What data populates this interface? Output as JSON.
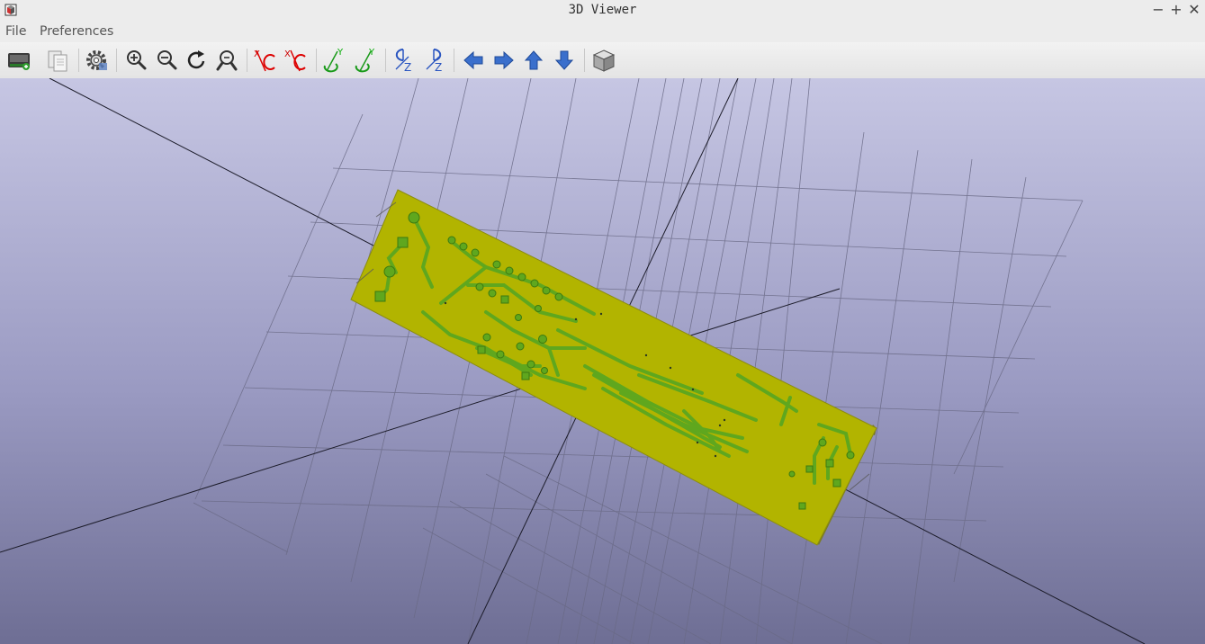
{
  "window": {
    "title": "3D Viewer",
    "minimize": "−",
    "maximize": "+",
    "close": "✕"
  },
  "menubar": {
    "file": "File",
    "preferences": "Preferences"
  },
  "toolbar": {
    "buttons": [
      {
        "name": "save-image-button",
        "icon": "camera-save-icon"
      },
      {
        "name": "copy-to-clipboard-button",
        "icon": "copy-icon"
      },
      {
        "name": "settings-button",
        "icon": "gear-icon"
      },
      {
        "name": "zoom-in-button",
        "icon": "zoom-in-icon"
      },
      {
        "name": "zoom-out-button",
        "icon": "zoom-out-icon"
      },
      {
        "name": "redraw-button",
        "icon": "refresh-icon"
      },
      {
        "name": "zoom-fit-button",
        "icon": "zoom-fit-icon"
      },
      {
        "name": "rotate-x-ccw-button",
        "icon": "rotate-x-icon",
        "axis": "X"
      },
      {
        "name": "rotate-x-cw-button",
        "icon": "rotate-x-icon",
        "axis": "X"
      },
      {
        "name": "rotate-y-ccw-button",
        "icon": "rotate-y-icon",
        "axis": "Y"
      },
      {
        "name": "rotate-y-cw-button",
        "icon": "rotate-y-icon",
        "axis": "Y"
      },
      {
        "name": "rotate-z-ccw-button",
        "icon": "rotate-z-icon",
        "axis": "Z"
      },
      {
        "name": "rotate-z-cw-button",
        "icon": "rotate-z-icon",
        "axis": "Z"
      },
      {
        "name": "pan-left-button",
        "icon": "arrow-left-icon"
      },
      {
        "name": "pan-right-button",
        "icon": "arrow-right-icon"
      },
      {
        "name": "pan-up-button",
        "icon": "arrow-up-icon"
      },
      {
        "name": "pan-down-button",
        "icon": "arrow-down-icon"
      },
      {
        "name": "ortho-toggle-button",
        "icon": "cube-icon"
      }
    ]
  },
  "scene": {
    "background_top": "#c6c6e3",
    "background_bottom": "#6e6e94",
    "board_color": "#b2b400",
    "copper_color": "#5fa71e",
    "grid_color": "#6a6a86"
  }
}
